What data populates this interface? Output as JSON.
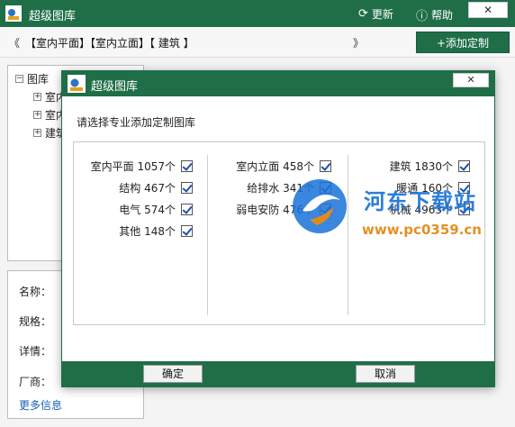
{
  "window": {
    "title": "超级图库",
    "refresh_label": "更新",
    "help_label": "帮助",
    "close_label": "✕"
  },
  "crumbbar": {
    "prev_glyph": "《",
    "path": "【室内平面】【室内立面】【   建筑   】",
    "next_glyph": "》",
    "add_button": "+添加定制"
  },
  "tree": {
    "root": "图库",
    "children": [
      "室内",
      "室内",
      "建筑"
    ]
  },
  "details": {
    "name_label": "名称：",
    "spec_label": "规格：",
    "detail_label": "详情：",
    "vendor_label": "厂商：",
    "more_link": "更多信息"
  },
  "modal": {
    "title": "超级图库",
    "close_label": "✕",
    "prompt": "请选择专业添加定制图库",
    "columns": [
      [
        {
          "label": "室内平面 1057个",
          "checked": true
        },
        {
          "label": "结构 467个",
          "checked": true
        },
        {
          "label": "电气 574个",
          "checked": true
        },
        {
          "label": "其他 148个",
          "checked": true
        }
      ],
      [
        {
          "label": "室内立面 458个",
          "checked": true
        },
        {
          "label": "给排水 341个",
          "checked": true
        },
        {
          "label": "弱电安防 476个",
          "checked": true
        }
      ],
      [
        {
          "label": "建筑 1830个",
          "checked": true
        },
        {
          "label": "暖通 160个",
          "checked": true
        },
        {
          "label": "机械 4963个",
          "checked": true
        }
      ]
    ],
    "ok_button": "确定",
    "cancel_button": "取消"
  },
  "watermark": {
    "name": "河东下载站",
    "url": "www.pc0359.cn"
  },
  "colors": {
    "brand_green": "#1f6e48",
    "watermark_blue": "#1a72d8",
    "watermark_orange": "#e38b1a"
  }
}
